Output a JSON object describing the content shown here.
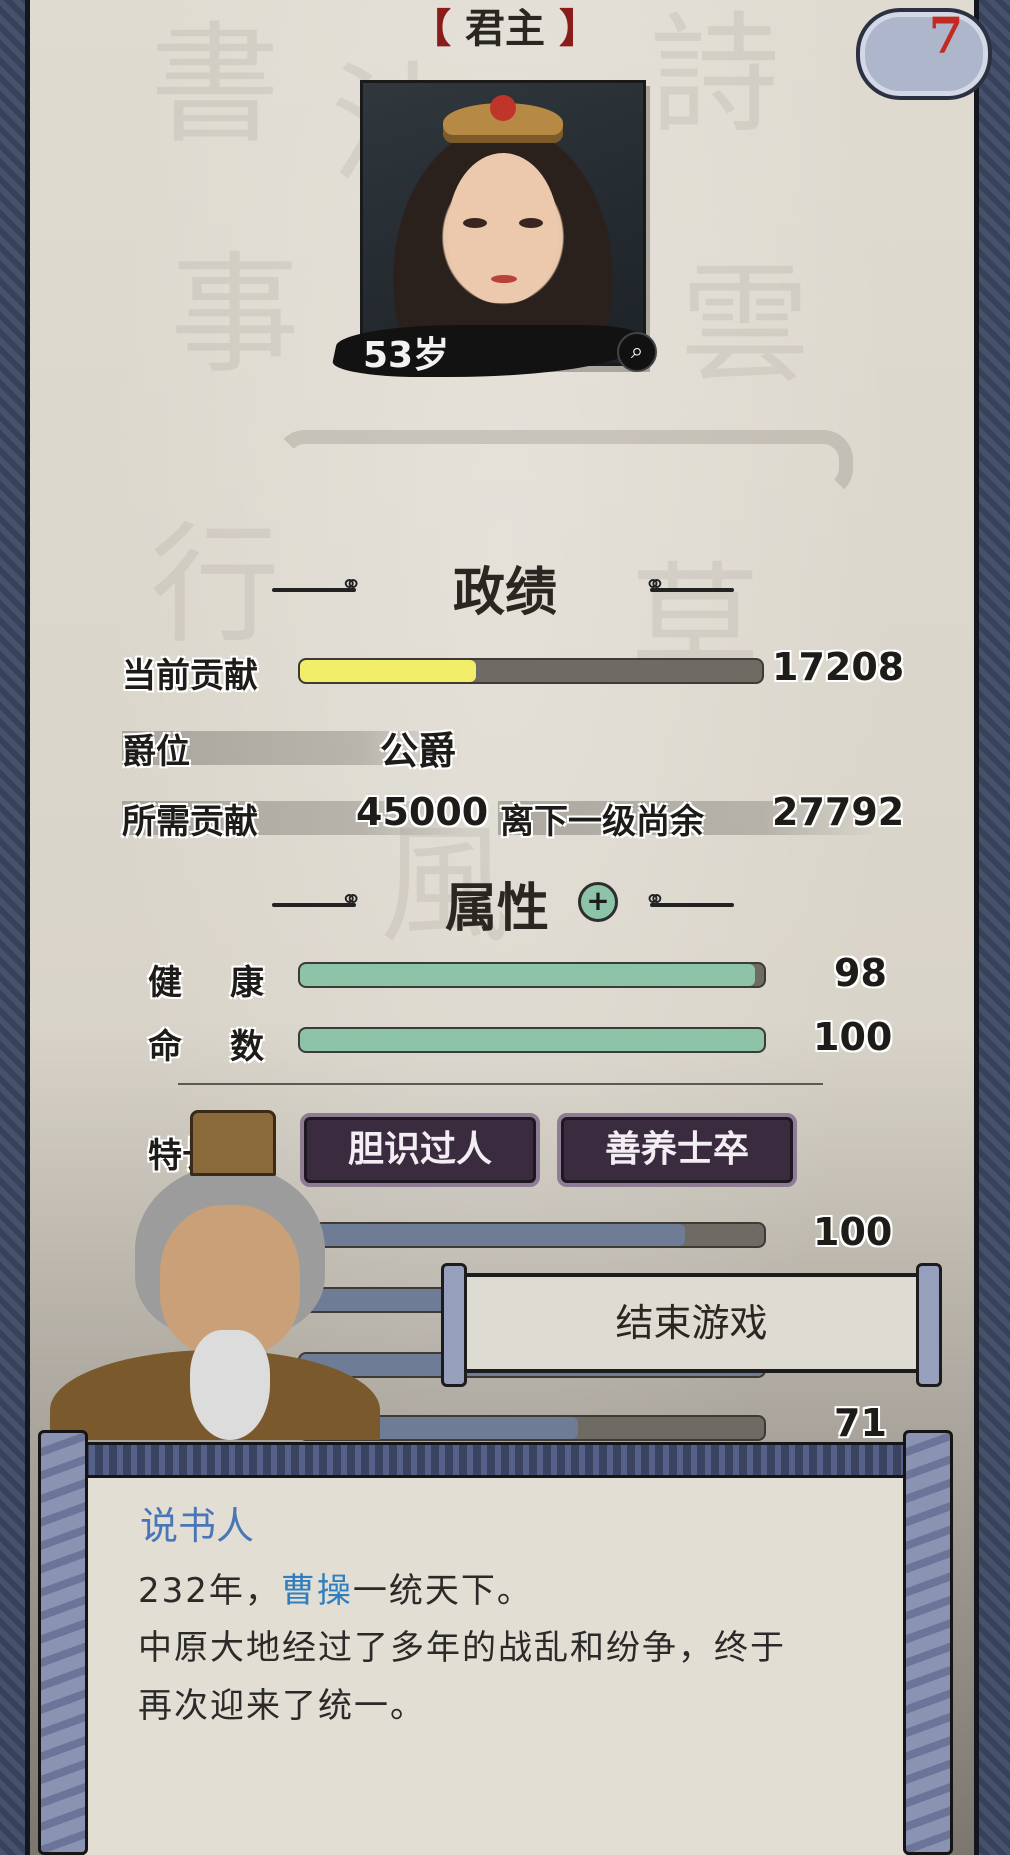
{
  "header": {
    "title_bracket_left": "【",
    "title": "君主",
    "title_bracket_right": "】",
    "turns_left": "7"
  },
  "portrait": {
    "age": "53岁",
    "zoom_icon": "search-icon"
  },
  "politics": {
    "heading": "政绩",
    "current_contribution_label": "当前贡献",
    "current_contribution_value": "17208",
    "current_contribution_progress": 0.38,
    "rank_label": "爵位",
    "rank_value": "公爵",
    "required_label": "所需贡献",
    "required_value": "45000",
    "remaining_label": "离下一级尚余",
    "remaining_value": "27792"
  },
  "attributes": {
    "heading": "属性",
    "add_icon": "plus-circle-icon",
    "health_label_1": "健",
    "health_label_2": "康",
    "health_value": "98",
    "health_progress": 0.98,
    "fate_label_1": "命",
    "fate_label_2": "数",
    "fate_value": "100",
    "fate_progress": 1.0,
    "traits_label": "特长",
    "traits": [
      "胆识过人",
      "善养士卒"
    ],
    "stat_value_1": "100",
    "stat_progress_1": 0.83,
    "stat_value_4": "71",
    "stat_progress_4": 0.6
  },
  "end_game": {
    "label": "结束游戏"
  },
  "dialog": {
    "speaker": "说书人",
    "line1_prefix": "232年，",
    "line1_name": "曹操",
    "line1_suffix": "一统天下。",
    "line2": "中原大地经过了多年的战乱和纷争，终于",
    "line3": "再次迎来了统一。"
  },
  "colors": {
    "contribution_fill": "#f2ee6a",
    "health_fill": "#8dc3a8",
    "stat_fill": "#6f7c96",
    "trait_bg": "#3b2b3e",
    "speaker": "#4a76b8",
    "highlight_name": "#2f7fbf"
  }
}
